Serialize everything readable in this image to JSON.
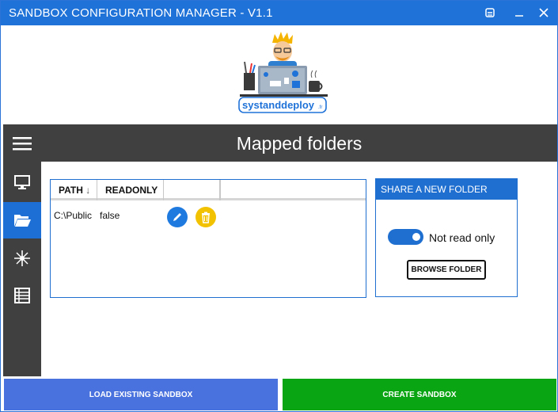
{
  "window": {
    "title": "SANDBOX CONFIGURATION MANAGER - V1.1"
  },
  "logo": {
    "text": "systanddeploy",
    "suffix": ".fr"
  },
  "header": {
    "title": "Mapped folders"
  },
  "table": {
    "columns": [
      "PATH",
      "READONLY"
    ],
    "sort_indicator": "↓",
    "rows": [
      {
        "path": "C:\\Public",
        "readonly": "false"
      }
    ]
  },
  "share": {
    "title": "SHARE A NEW FOLDER",
    "toggle_label": "Not read only",
    "browse_label": "BROWSE FOLDER"
  },
  "buttons": {
    "load": "LOAD EXISTING SANDBOX",
    "create": "CREATE SANDBOX"
  },
  "colors": {
    "accent": "#1f72d8",
    "sidebar": "#404040",
    "edit": "#1f7ae0",
    "delete": "#f2c200",
    "create": "#0aa513",
    "load": "#4a72de"
  },
  "icons": {
    "settings": "settings-icon",
    "minimize": "minimize-icon",
    "close": "close-icon",
    "menu": "hamburger-menu-icon",
    "monitor": "monitor-icon",
    "folder": "folder-open-icon",
    "network": "network-icon",
    "list": "list-icon",
    "edit": "pencil-icon",
    "delete": "trash-icon"
  }
}
